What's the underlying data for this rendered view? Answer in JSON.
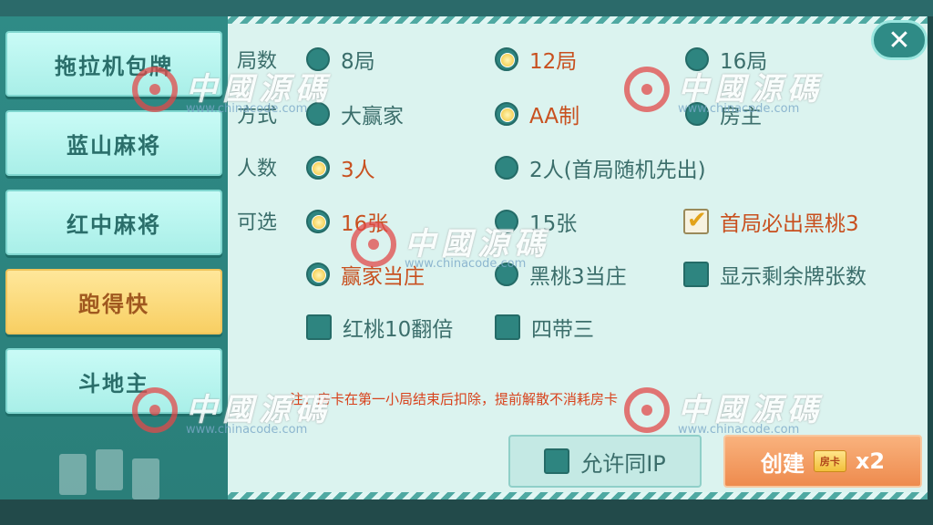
{
  "menu": [
    {
      "label": "拖拉机包牌",
      "active": false
    },
    {
      "label": "蓝山麻将",
      "active": false
    },
    {
      "label": "红中麻将",
      "active": false
    },
    {
      "label": "跑得快",
      "active": true
    },
    {
      "label": "斗地主",
      "active": false
    }
  ],
  "labels": {
    "rounds": "局数",
    "mode": "方式",
    "players": "人数",
    "optional": "可选"
  },
  "rounds_options": [
    {
      "label": "8局",
      "selected": false
    },
    {
      "label": "12局",
      "selected": true
    },
    {
      "label": "16局",
      "selected": false
    }
  ],
  "mode_options": [
    {
      "label": "大赢家",
      "selected": false
    },
    {
      "label": "AA制",
      "selected": true
    },
    {
      "label": "房主",
      "selected": false
    }
  ],
  "players_options": [
    {
      "label": "3人",
      "selected": true
    },
    {
      "label": "2人(首局随机先出)",
      "selected": false
    }
  ],
  "card_count_options": [
    {
      "label": "16张",
      "selected": true
    },
    {
      "label": "15张",
      "selected": false
    }
  ],
  "first_spade3_check": {
    "label": "首局必出黑桃3",
    "checked": true
  },
  "dealer_options": [
    {
      "label": "赢家当庄",
      "selected": true
    },
    {
      "label": "黑桃3当庄",
      "selected": false
    }
  ],
  "show_remaining_check": {
    "label": "显示剩余牌张数",
    "checked": false
  },
  "heart10_check": {
    "label": "红桃10翻倍",
    "checked": false
  },
  "four_with_three_check": {
    "label": "四带三",
    "checked": false
  },
  "note": "注：房卡在第一小局结束后扣除，提前解散不消耗房卡",
  "allow_same_ip": {
    "label": "允许同IP",
    "checked": false
  },
  "create_button": {
    "label": "创建",
    "card_text": "房卡",
    "cost": "x2"
  },
  "close_icon": "close-icon",
  "watermark": {
    "text": "中國源碼",
    "url": "www.chinacode.com"
  },
  "colors": {
    "selected_text": "#c8501f",
    "active_menu": "#f8cf63",
    "create_button": "#ee8b4e"
  }
}
